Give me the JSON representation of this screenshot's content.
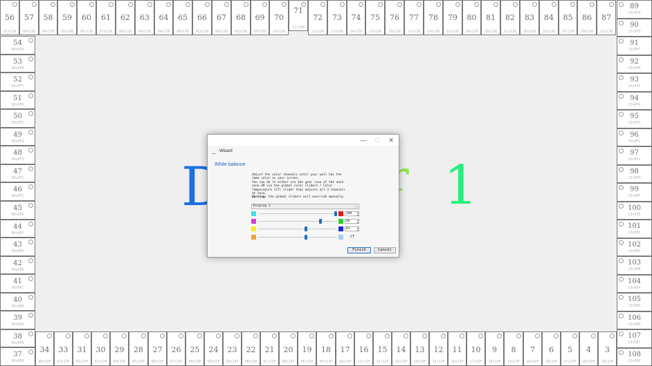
{
  "background_color": "#efefef",
  "zones": {
    "top": [
      {
        "n": "56",
        "a": "01x138"
      },
      {
        "n": "57",
        "a": "00x138"
      },
      {
        "n": "58",
        "a": "04x138"
      },
      {
        "n": "59",
        "a": "05x138"
      },
      {
        "n": "60",
        "a": "06x138"
      },
      {
        "n": "61",
        "a": "07x138"
      },
      {
        "n": "62",
        "a": "08x138"
      },
      {
        "n": "63",
        "a": "09x138"
      },
      {
        "n": "64",
        "a": "0Ax138"
      },
      {
        "n": "65",
        "a": "0Bx138"
      },
      {
        "n": "66",
        "a": "0Cx138"
      },
      {
        "n": "67",
        "a": "0Dx138"
      },
      {
        "n": "68",
        "a": "0Ex138"
      },
      {
        "n": "69",
        "a": "0Fx138"
      },
      {
        "n": "70",
        "a": "10x138"
      },
      {
        "n": "71",
        "a": "11x138"
      },
      {
        "n": "72",
        "a": "12x138"
      },
      {
        "n": "73",
        "a": "13x138"
      },
      {
        "n": "74",
        "a": "14x138"
      },
      {
        "n": "75",
        "a": "15x138"
      },
      {
        "n": "76",
        "a": "16x138"
      },
      {
        "n": "77",
        "a": "17x138"
      },
      {
        "n": "78",
        "a": "18x138"
      },
      {
        "n": "79",
        "a": "19x138"
      },
      {
        "n": "80",
        "a": "1Ax138"
      },
      {
        "n": "81",
        "a": "1Bx138"
      },
      {
        "n": "82",
        "a": "1Cx138"
      },
      {
        "n": "83",
        "a": "1Dx138"
      },
      {
        "n": "84",
        "a": "1Ex138"
      },
      {
        "n": "85",
        "a": "1Fx138"
      },
      {
        "n": "86",
        "a": "20x138"
      },
      {
        "n": "87",
        "a": "21x138"
      }
    ],
    "right": [
      {
        "n": "89",
        "a": "23x0F9"
      },
      {
        "n": "90",
        "a": "23x0F8"
      },
      {
        "n": "91",
        "a": "23x0F7"
      },
      {
        "n": "92",
        "a": "23x0F6"
      },
      {
        "n": "93",
        "a": "23x0F5"
      },
      {
        "n": "94",
        "a": "23x0F4"
      },
      {
        "n": "95",
        "a": "23x0F3"
      },
      {
        "n": "96",
        "a": "23x0F2"
      },
      {
        "n": "97",
        "a": "23x0F1"
      },
      {
        "n": "98",
        "a": "23x0F0"
      },
      {
        "n": "99",
        "a": "23x0EF"
      },
      {
        "n": "100",
        "a": "23x0EE"
      },
      {
        "n": "101",
        "a": "23x0ED"
      },
      {
        "n": "102",
        "a": "23x0EC"
      },
      {
        "n": "103",
        "a": "23x0EB"
      },
      {
        "n": "104",
        "a": "23x0EA"
      },
      {
        "n": "105",
        "a": "23x0E9"
      },
      {
        "n": "106",
        "a": "23x0E8"
      },
      {
        "n": "107",
        "a": "23x0E7"
      },
      {
        "n": "108",
        "a": "23x0E6"
      }
    ],
    "left": [
      {
        "n": "54",
        "a": "00x0F9"
      },
      {
        "n": "53",
        "a": "00x0F8"
      },
      {
        "n": "52",
        "a": "00x0F7"
      },
      {
        "n": "51",
        "a": "00x0F6"
      },
      {
        "n": "50",
        "a": "00x0F5"
      },
      {
        "n": "49",
        "a": "00x0F4"
      },
      {
        "n": "48",
        "a": "00x0F3"
      },
      {
        "n": "47",
        "a": "00x0F2"
      },
      {
        "n": "46",
        "a": "00x0F1"
      },
      {
        "n": "45",
        "a": "00x0F0"
      },
      {
        "n": "44",
        "a": "00x0EF"
      },
      {
        "n": "43",
        "a": "00x0EE"
      },
      {
        "n": "42",
        "a": "00x0ED"
      },
      {
        "n": "41",
        "a": "00x0EC"
      },
      {
        "n": "40",
        "a": "00x0EB"
      },
      {
        "n": "39",
        "a": "00x0EA"
      },
      {
        "n": "38",
        "a": "00x0E9"
      },
      {
        "n": "37",
        "a": "00x0E8"
      }
    ],
    "bottom": [
      {
        "n": "34",
        "a": "00x13F"
      },
      {
        "n": "33",
        "a": "01x13F"
      },
      {
        "n": "31",
        "a": "02x13F"
      },
      {
        "n": "30",
        "a": "03x13F"
      },
      {
        "n": "29",
        "a": "04x13F"
      },
      {
        "n": "28",
        "a": "05x13F"
      },
      {
        "n": "27",
        "a": "06x13F"
      },
      {
        "n": "26",
        "a": "07x13F"
      },
      {
        "n": "25",
        "a": "08x13F"
      },
      {
        "n": "24",
        "a": "09x13F"
      },
      {
        "n": "23",
        "a": "0Ax13F"
      },
      {
        "n": "22",
        "a": "0Bx13F"
      },
      {
        "n": "21",
        "a": "0Cx13F"
      },
      {
        "n": "20",
        "a": "0Dx13F"
      },
      {
        "n": "19",
        "a": "0Ex13F"
      },
      {
        "n": "18",
        "a": "0Fx13F"
      },
      {
        "n": "17",
        "a": "10x13F"
      },
      {
        "n": "16",
        "a": "11x13F"
      },
      {
        "n": "15",
        "a": "12x13F"
      },
      {
        "n": "14",
        "a": "13x13F"
      },
      {
        "n": "13",
        "a": "14x13F"
      },
      {
        "n": "12",
        "a": "15x13F"
      },
      {
        "n": "11",
        "a": "16x13F"
      },
      {
        "n": "10",
        "a": "17x13F"
      },
      {
        "n": "9",
        "a": "18x13F"
      },
      {
        "n": "8",
        "a": "19x13F"
      },
      {
        "n": "7",
        "a": "1Ax13F"
      },
      {
        "n": "6",
        "a": "1Bx13F"
      },
      {
        "n": "5",
        "a": "1Cx13F"
      },
      {
        "n": "4",
        "a": "1Dx13F"
      },
      {
        "n": "3",
        "a": "1Ex13F"
      }
    ]
  },
  "display_label": {
    "left_glyph": "D",
    "left_color": "#1e6fe0",
    "mid_glyph": "r",
    "mid_color": "#8fe34a",
    "right_glyph": "1",
    "right_color": "#26f07d"
  },
  "dialog": {
    "title": "Wizard",
    "back_icon": "back-arrow-icon",
    "page_title": "White balance",
    "description": "Adjust the color channels until your wall has the\nsame color as your screen.\nYou can do it either via the gear icon of the each\nzone OR via the global color sliders / Color\nTemperature (CT) slider that adjusts all 3 channels\nat once.",
    "warning_label": "Warning:",
    "warning_text": " the global sliders will override manually",
    "display_select": "Display 1",
    "channels": [
      {
        "name": "cyan",
        "swatch": "#3fe0ee",
        "output": "#e01818",
        "value": "100",
        "level": 1.0
      },
      {
        "name": "magenta",
        "swatch": "#d63fd6",
        "output": "#22d12a",
        "value": "80",
        "level": 0.8
      },
      {
        "name": "yellow",
        "swatch": "#f2f21a",
        "output": "#1e2ad0",
        "value": "61",
        "level": 0.61
      },
      {
        "name": "ct",
        "swatch": "#f0a040",
        "output": "#a9c9ee",
        "value": "CT",
        "level": 0.61
      }
    ],
    "finish_label": "Finish",
    "cancel_label": "Cancel"
  }
}
